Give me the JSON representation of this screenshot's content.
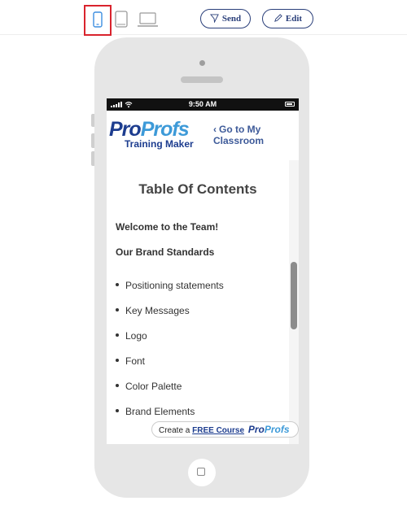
{
  "toolbar": {
    "devices": [
      {
        "name": "phone",
        "icon": "phone-icon",
        "selected": true
      },
      {
        "name": "tablet",
        "icon": "tablet-icon",
        "selected": false
      },
      {
        "name": "desktop",
        "icon": "laptop-icon",
        "selected": false
      }
    ],
    "send_label": "Send",
    "edit_label": "Edit",
    "accent_color": "#2a3f7a",
    "selected_border_color": "#d9232d"
  },
  "statusbar": {
    "time": "9:50 AM"
  },
  "header": {
    "logo_part1": "Pro",
    "logo_part2": "Profs",
    "logo_subtitle": "Training Maker",
    "go_link_line1": "Go to My",
    "go_link_line2": "Classroom"
  },
  "content": {
    "title": "Table Of Contents",
    "sections": [
      "Welcome to the Team!",
      "Our Brand Standards"
    ],
    "items": [
      "Positioning statements",
      "Key Messages",
      "Logo",
      "Font",
      "Color Palette",
      "Brand Elements"
    ]
  },
  "promo": {
    "prefix": "Create a ",
    "link_text": "FREE Course",
    "brand_part1": "Pro",
    "brand_part2": "Profs"
  },
  "colors": {
    "brand_dark_blue": "#1d3d8f",
    "brand_light_blue": "#3d9ad8",
    "phone_frame": "#e6e6e6"
  }
}
